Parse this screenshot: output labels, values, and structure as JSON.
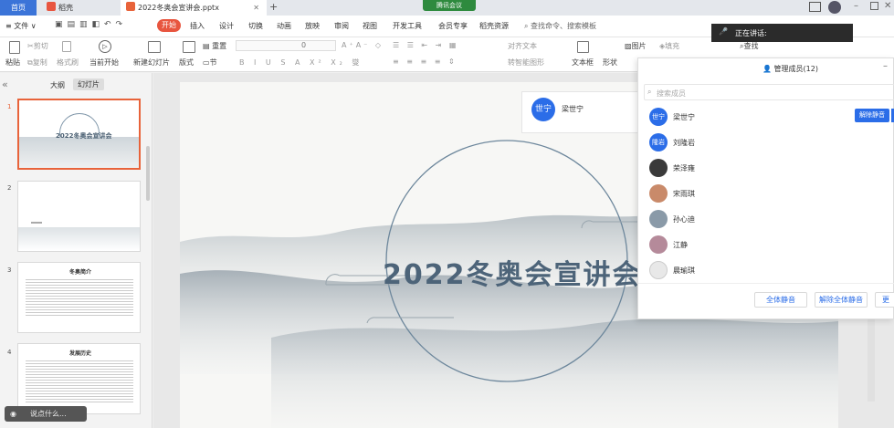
{
  "tabs": {
    "home": "首页",
    "wps": "稻壳",
    "doc": "2022冬奥会宣讲会.pptx"
  },
  "tencent_meeting": "腾讯会议",
  "menu": {
    "file": "文件",
    "start": "开始",
    "items": [
      "插入",
      "设计",
      "切换",
      "动画",
      "放映",
      "审阅",
      "视图",
      "开发工具",
      "会员专享",
      "稻壳资源"
    ],
    "search": "查找命令、搜索模板"
  },
  "toolbar": {
    "paste": "粘贴",
    "cut": "剪切",
    "copy": "复制",
    "format_painter": "格式刷",
    "from_current": "当前开始",
    "new_slide": "新建幻灯片",
    "layout": "版式",
    "section": "节",
    "reset": "重置",
    "font_size": "0",
    "align_text": "对齐文本",
    "smart_shape": "转智能图形",
    "textbox": "文本框",
    "shape": "形状",
    "picture": "图片",
    "fill": "填充",
    "find": "查找"
  },
  "left_panel": {
    "tab_outline": "大纲",
    "tab_slides": "幻灯片",
    "slides": [
      {
        "num": "1",
        "title": "2022冬奥会宣讲会"
      },
      {
        "num": "2",
        "title": ""
      },
      {
        "num": "3",
        "title": "冬奥简介"
      },
      {
        "num": "4",
        "title": "发展历史"
      }
    ]
  },
  "slide": {
    "title": "2022冬奥会宣讲会"
  },
  "speaker": {
    "avatar": "世宁",
    "name": "梁世宁"
  },
  "speaking": {
    "label": "正在讲话:"
  },
  "member_panel": {
    "title": "管理成员(12)",
    "search_placeholder": "搜索成员",
    "members": [
      {
        "name": "梁世宁",
        "avatar": "世宁",
        "color": "#2b6de8",
        "action": "解除静音"
      },
      {
        "name": "刘隆岩",
        "avatar": "隆岩",
        "color": "#2b6de8"
      },
      {
        "name": "荣泽雍",
        "avatar": "",
        "color": "#3a3a3a"
      },
      {
        "name": "宋雨琪",
        "avatar": "",
        "color": "#c98a6a"
      },
      {
        "name": "孙心迪",
        "avatar": "",
        "color": "#8a9aa8"
      },
      {
        "name": "江静",
        "avatar": "",
        "color": "#b58a9a"
      },
      {
        "name": "晨瑜琪",
        "avatar": "",
        "color": "#e8e8e8"
      }
    ],
    "buttons": {
      "mute_all": "全体静音",
      "unmute_all": "解除全体静音",
      "more": "更"
    }
  },
  "status": {
    "hint": "说点什么..."
  }
}
